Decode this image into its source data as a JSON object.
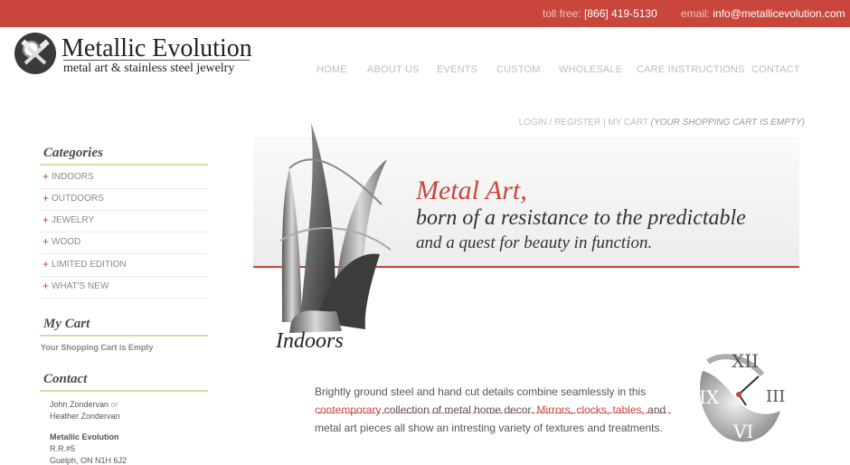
{
  "topbar": {
    "tollfree_label": "toll free:",
    "tollfree_value": "[866] 419-5130",
    "email_label": "email:",
    "email_value": "info@metallicevolution.com"
  },
  "logo": {
    "title": "Metallic Evolution",
    "tagline": "metal art & stainless steel jewelry"
  },
  "nav": [
    "HOME",
    "ABOUT US",
    "EVENTS",
    "CUSTOM",
    "WHOLESALE",
    "CARE INSTRUCTIONS",
    "CONTACT"
  ],
  "account": {
    "login": "LOGIN",
    "register": "REGISTER",
    "cart": "MY CART",
    "cart_status": "(YOUR SHOPPING CART IS EMPTY)"
  },
  "sidebar": {
    "categories_title": "Categories",
    "categories": [
      "INDOORS",
      "OUTDOORS",
      "JEWELRY",
      "WOOD",
      "LIMITED EDITION",
      "WHAT'S NEW"
    ],
    "cart_title": "My Cart",
    "cart_text": "Your Shopping Cart is Empty",
    "contact_title": "Contact",
    "contact_line1": "John Zondervan",
    "contact_or": "or",
    "contact_line2": "Heather Zondervan",
    "contact_company": "Metallic Evolution",
    "contact_rr": "R.R.#5",
    "contact_city": "Guelph, ON N1H 6J2"
  },
  "banner": {
    "headline_red": "Metal Art,",
    "headline_line1": "born of a resistance to the predictable",
    "headline_line2": "and a quest for beauty in function."
  },
  "section": {
    "title": "Indoors",
    "p1": "Brightly ground steel and hand cut details combine seamlessly in this",
    "p2_link": "contemporary",
    "p2_rest": " collection of metal home decor. ",
    "p2_mirrors": "Mirrors",
    "p2_c1": ", ",
    "p2_clocks": "clocks",
    "p2_c2": ", ",
    "p2_tables": "tables",
    "p2_end": ", and",
    "p3": "metal art pieces all show an intresting variety of textures and treatments."
  },
  "colors": {
    "accent": "#c9463d",
    "sidebar_rule": "#cfe0a8"
  },
  "icons": {
    "logo": "tools-logo-icon",
    "clock": "roman-clock-icon"
  }
}
